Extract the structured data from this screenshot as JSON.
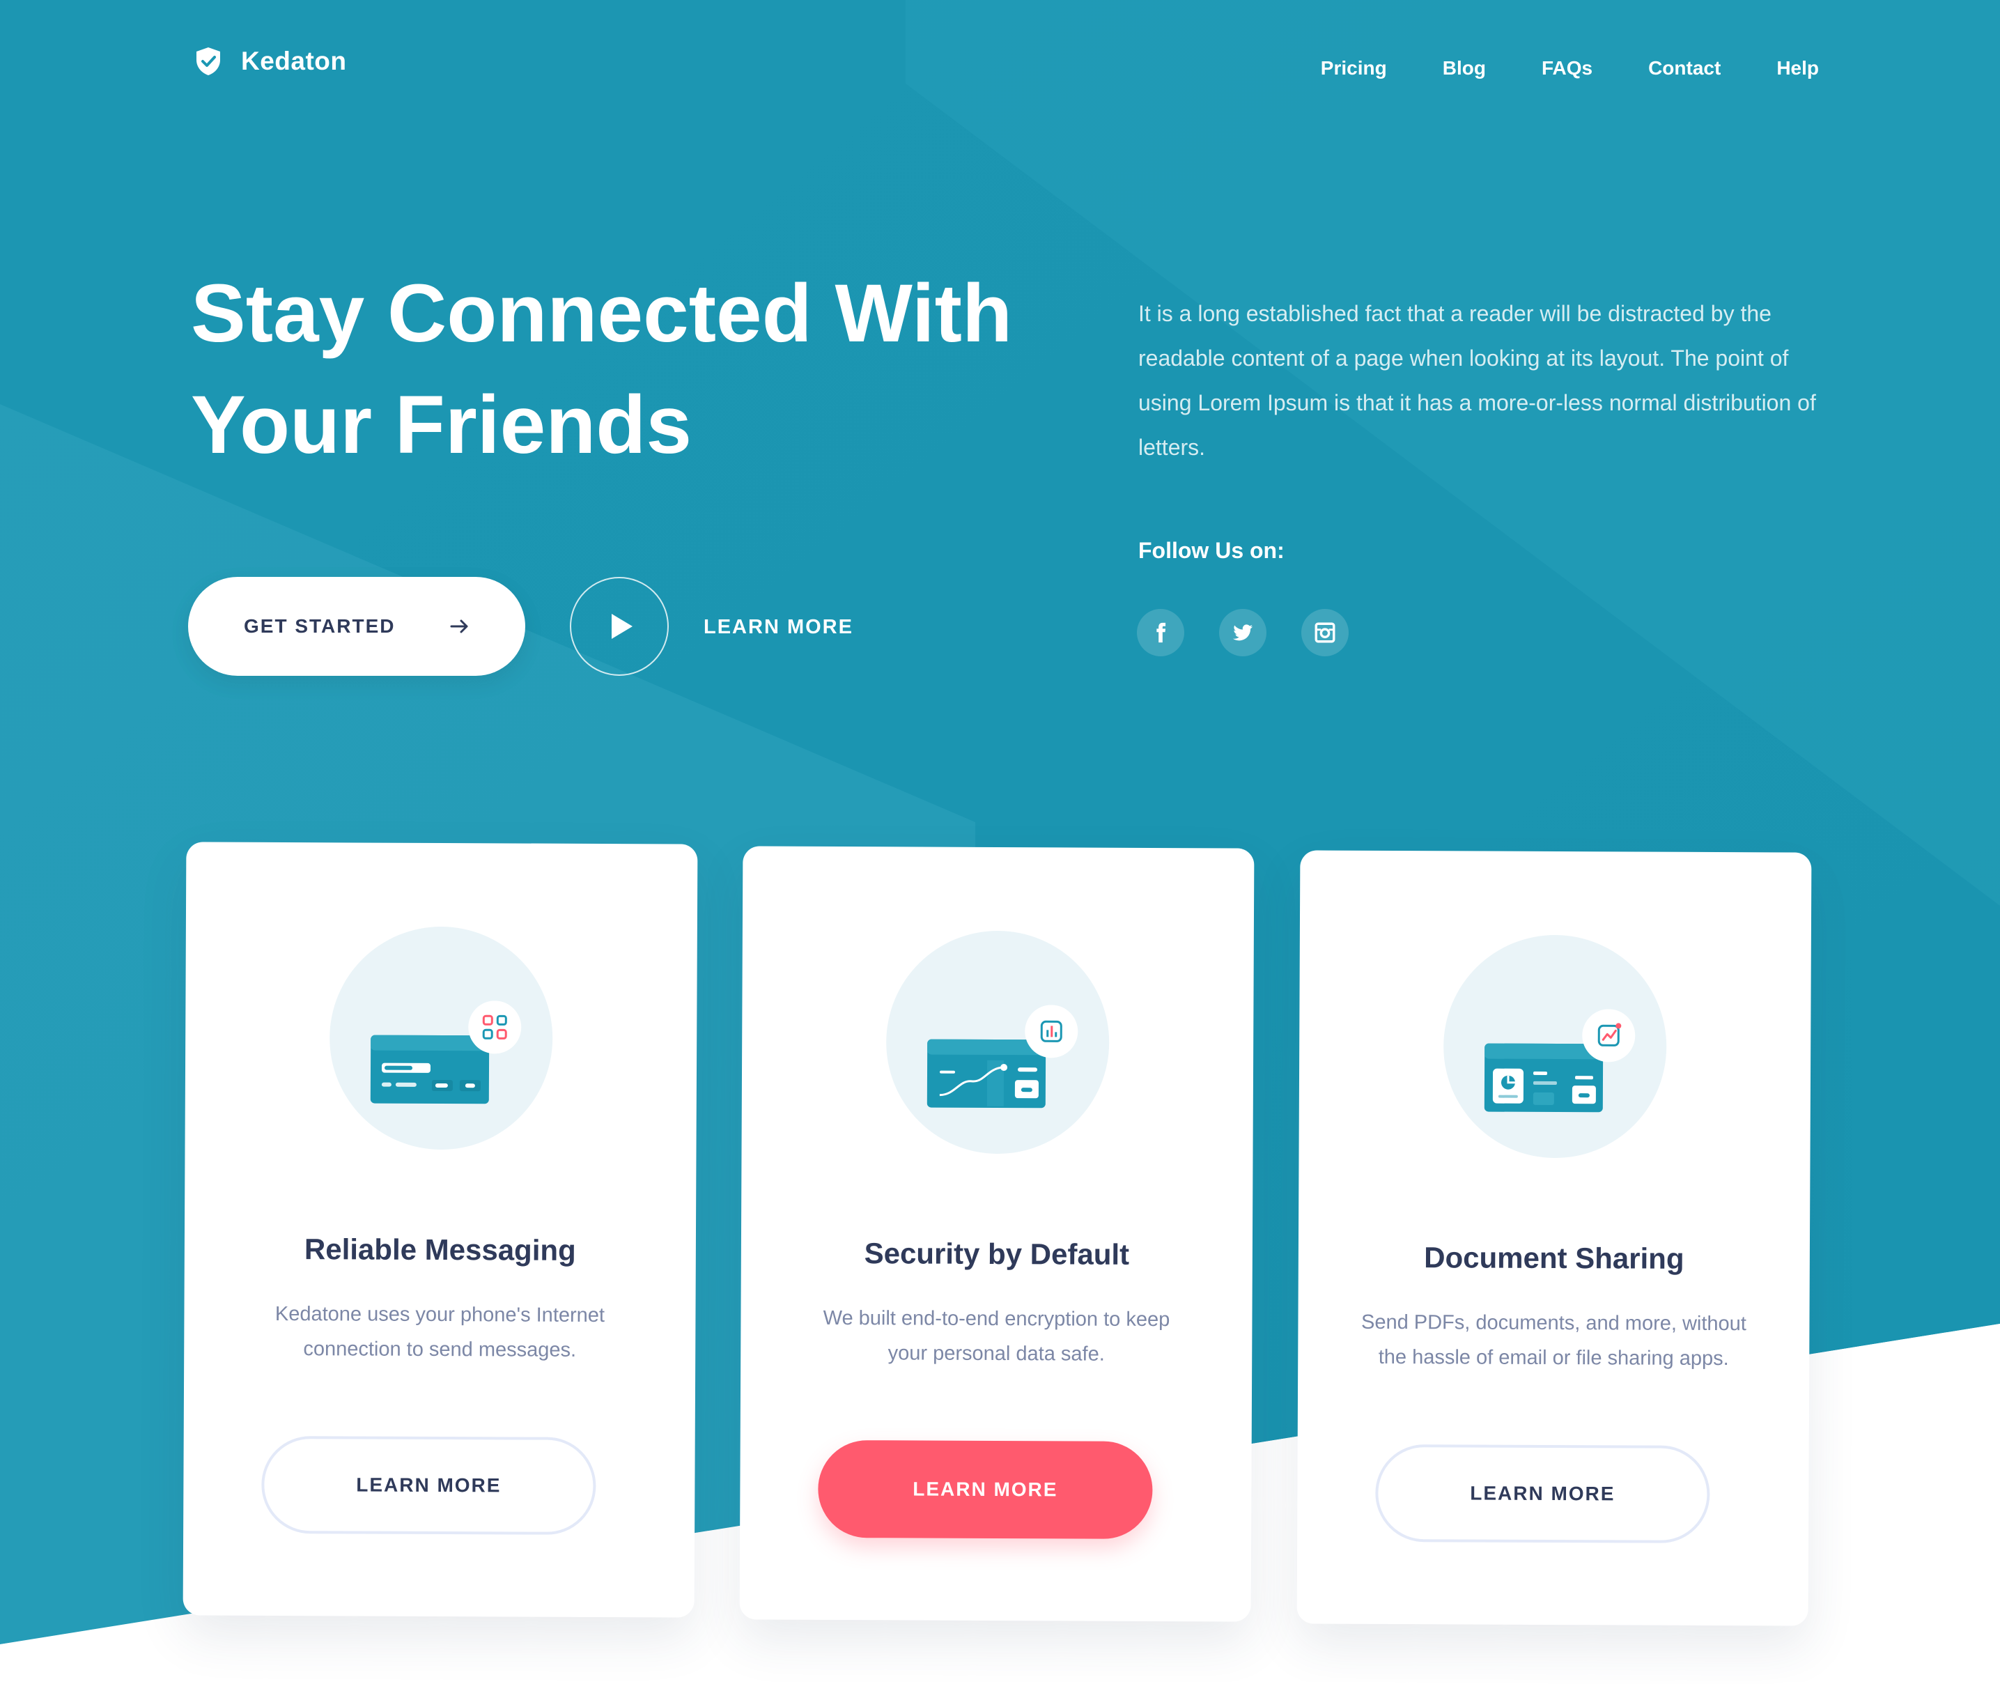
{
  "brand": {
    "name": "Kedaton",
    "logo_icon": "shield-check-icon"
  },
  "nav": {
    "items": [
      "Pricing",
      "Blog",
      "FAQs",
      "Contact",
      "Help"
    ]
  },
  "hero": {
    "title_line1": "Stay Connected With",
    "title_line2": "Your Friends",
    "description": "It is a long established fact that a reader will be distracted by the readable content of a page when looking at its layout. The point of using Lorem Ipsum is that it has a more-or-less normal distribution of letters.",
    "get_started_label": "GET STARTED",
    "learn_more_label": "LEARN MORE",
    "follow_label": "Follow Us on:",
    "social": [
      "facebook-icon",
      "twitter-icon",
      "instagram-icon"
    ]
  },
  "cards": [
    {
      "title": "Reliable Messaging",
      "text": "Kedatone uses your phone's Internet connection to send messages.",
      "button": "LEARN MORE",
      "badge_icon": "grid-icon"
    },
    {
      "title": "Security by Default",
      "text": "We built end-to-end encryption to keep your personal data safe.",
      "button": "LEARN MORE",
      "badge_icon": "bar-chart-icon"
    },
    {
      "title": "Document Sharing",
      "text": "Send PDFs, documents, and more, without the hassle of email or file sharing apps.",
      "button": "LEARN MORE",
      "badge_icon": "trend-chart-icon"
    }
  ],
  "colors": {
    "primary": "#1b97b3",
    "accent": "#ff5a6e",
    "text_dark": "#2f3a5a",
    "text_muted": "#7c87a6"
  }
}
